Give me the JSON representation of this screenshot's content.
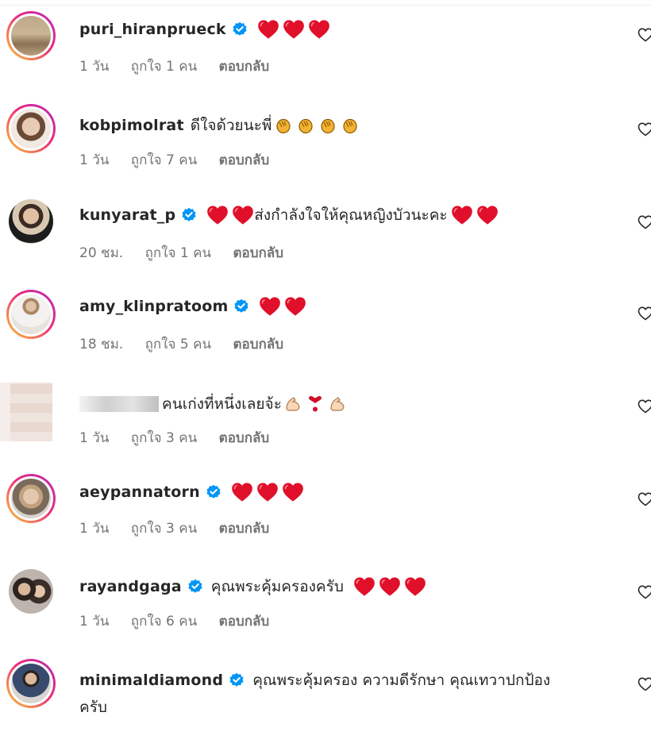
{
  "colors": {
    "heart": "#e0102a",
    "verified": "#0095f6",
    "meta": "#737373"
  },
  "comments": [
    {
      "username": "puri_hiranprueck",
      "verified": true,
      "text": "",
      "hearts": 3,
      "time": "1 วัน",
      "likes": "ถูกใจ 1 คน",
      "reply": "ตอบกลับ"
    },
    {
      "username": "kobpimolrat",
      "verified": false,
      "text": "ดีใจด้วยนะพี่",
      "hearts": 0,
      "time": "1 วัน",
      "likes": "ถูกใจ 7 คน",
      "reply": "ตอบกลับ"
    },
    {
      "username": "kunyarat_p",
      "verified": true,
      "text": "ส่งกำลังใจให้คุณหญิงบัวนะคะ",
      "hearts": 2,
      "time": "20 ชม.",
      "likes": "ถูกใจ 1 คน",
      "reply": "ตอบกลับ"
    },
    {
      "username": "amy_klinpratoom",
      "verified": true,
      "text": "",
      "hearts": 2,
      "time": "18 ชม.",
      "likes": "ถูกใจ 5 คน",
      "reply": "ตอบกลับ"
    },
    {
      "username": "",
      "verified": false,
      "text": "คนเก่งที่หนึ่งเลยจ้ะ",
      "hearts": 0,
      "time": "1 วัน",
      "likes": "ถูกใจ 3 คน",
      "reply": "ตอบกลับ"
    },
    {
      "username": "aeypannatorn",
      "verified": true,
      "text": "",
      "hearts": 3,
      "time": "1 วัน",
      "likes": "ถูกใจ 3 คน",
      "reply": "ตอบกลับ"
    },
    {
      "username": "rayandgaga",
      "verified": true,
      "text": "คุณพระคุ้มครองครับ",
      "hearts": 3,
      "time": "1 วัน",
      "likes": "ถูกใจ 6 คน",
      "reply": "ตอบกลับ"
    },
    {
      "username": "minimaldiamond",
      "verified": true,
      "text": "คุณพระคุ้มครอง ความดีรักษา คุณเทวาปกป้อง",
      "text_line2": "ครับ",
      "hearts": 0
    }
  ]
}
